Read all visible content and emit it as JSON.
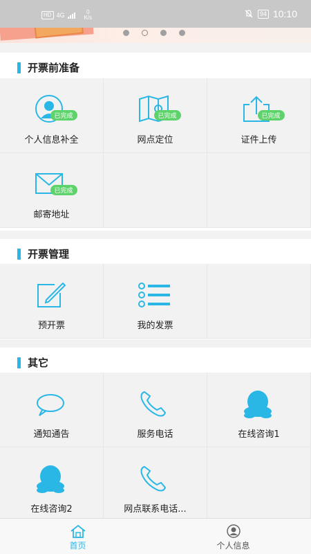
{
  "status_bar": {
    "hd": "HD",
    "signal": "4G",
    "speed_value": "0",
    "speed_unit": "K/s",
    "battery": "94",
    "time": "10:10"
  },
  "banner": {
    "dots_count": 4,
    "active_index": 1
  },
  "sections": [
    {
      "title": "开票前准备",
      "items": [
        {
          "label": "个人信息补全",
          "icon": "user-avatar-icon",
          "badge": "已完成"
        },
        {
          "label": "网点定位",
          "icon": "map-location-icon",
          "badge": "已完成"
        },
        {
          "label": "证件上传",
          "icon": "upload-icon",
          "badge": "已完成"
        },
        {
          "label": "邮寄地址",
          "icon": "envelope-icon",
          "badge": "已完成"
        }
      ]
    },
    {
      "title": "开票管理",
      "items": [
        {
          "label": "预开票",
          "icon": "edit-icon"
        },
        {
          "label": "我的发票",
          "icon": "list-icon"
        }
      ]
    },
    {
      "title": "其它",
      "items": [
        {
          "label": "通知通告",
          "icon": "chat-bubble-icon"
        },
        {
          "label": "服务电话",
          "icon": "phone-icon"
        },
        {
          "label": "在线咨询1",
          "icon": "qq-penguin-icon"
        },
        {
          "label": "在线咨询2",
          "icon": "qq-penguin-icon"
        },
        {
          "label": "网点联系电话...",
          "icon": "phone-icon"
        }
      ]
    }
  ],
  "bottom_nav": {
    "home": "首页",
    "profile": "个人信息"
  },
  "colors": {
    "accent": "#2bb7e6",
    "badge": "#5fd36b"
  }
}
